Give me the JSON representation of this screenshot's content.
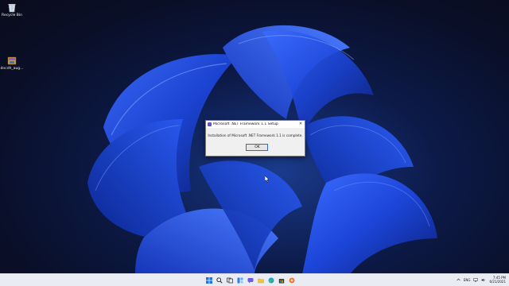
{
  "desktop": {
    "icons": [
      {
        "label": "Recycle Bin"
      },
      {
        "label": "dncdh_aug..."
      }
    ]
  },
  "dialog": {
    "title": "Microsoft .NET Framework 1.1 Setup",
    "close_glyph": "✕",
    "message": "Installation of Microsoft .NET Framework 1.1 is complete.",
    "ok_label": "OK"
  },
  "taskbar": {
    "items": [
      "windows-start-icon",
      "search-icon",
      "task-view-icon",
      "widgets-icon",
      "chat-icon",
      "file-explorer-icon",
      "edge-icon",
      "store-icon",
      "app-icon"
    ],
    "language": "ENG",
    "time": "7:45 PM",
    "date": "6/21/2021"
  },
  "colors": {
    "accent": "#2d6ad6",
    "wallpaper_deep": "#0a0f28",
    "wallpaper_bloom": "#1f4fe0"
  }
}
